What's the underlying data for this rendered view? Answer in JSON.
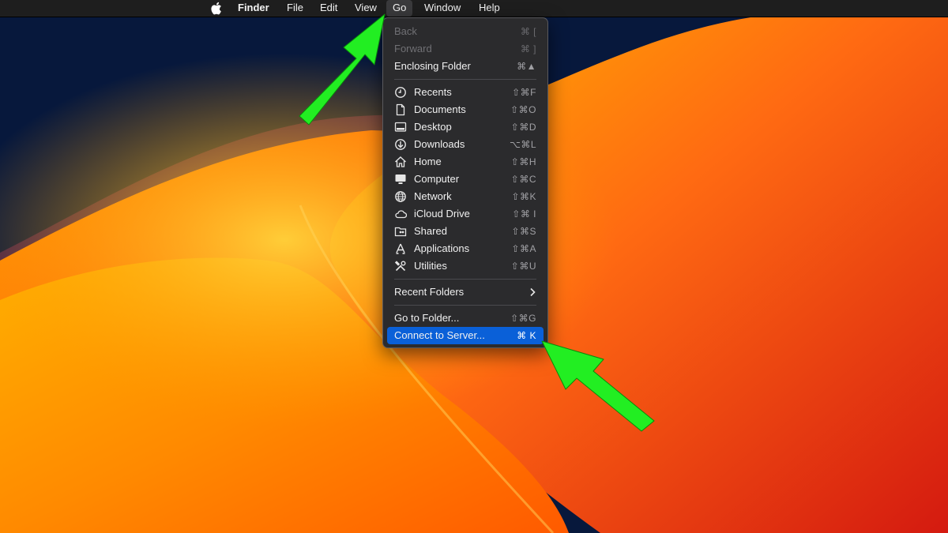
{
  "menubar": {
    "apple_icon": "apple-logo-icon",
    "items": [
      {
        "label": "Finder"
      },
      {
        "label": "File"
      },
      {
        "label": "Edit"
      },
      {
        "label": "View"
      },
      {
        "label": "Go"
      },
      {
        "label": "Window"
      },
      {
        "label": "Help"
      }
    ],
    "active_item": "Go"
  },
  "go_menu": {
    "history": [
      {
        "label": "Back",
        "shortcut": "⌘ [",
        "enabled": false
      },
      {
        "label": "Forward",
        "shortcut": "⌘ ]",
        "enabled": false
      },
      {
        "label": "Enclosing Folder",
        "shortcut": "⌘▲",
        "enabled": true
      }
    ],
    "places": [
      {
        "label": "Recents",
        "shortcut": "⇧⌘F",
        "icon": "clock-icon"
      },
      {
        "label": "Documents",
        "shortcut": "⇧⌘O",
        "icon": "document-icon"
      },
      {
        "label": "Desktop",
        "shortcut": "⇧⌘D",
        "icon": "desktop-icon"
      },
      {
        "label": "Downloads",
        "shortcut": "⌥⌘L",
        "icon": "download-icon"
      },
      {
        "label": "Home",
        "shortcut": "⇧⌘H",
        "icon": "home-icon"
      },
      {
        "label": "Computer",
        "shortcut": "⇧⌘C",
        "icon": "computer-icon"
      },
      {
        "label": "Network",
        "shortcut": "⇧⌘K",
        "icon": "globe-icon"
      },
      {
        "label": "iCloud Drive",
        "shortcut": "⇧⌘ I",
        "icon": "cloud-icon"
      },
      {
        "label": "Shared",
        "shortcut": "⇧⌘S",
        "icon": "shared-folder-icon"
      },
      {
        "label": "Applications",
        "shortcut": "⇧⌘A",
        "icon": "applications-icon"
      },
      {
        "label": "Utilities",
        "shortcut": "⇧⌘U",
        "icon": "utilities-icon"
      }
    ],
    "recent_folders": {
      "label": "Recent Folders",
      "icon": "chevron-right-icon"
    },
    "go_to_folder": {
      "label": "Go to Folder...",
      "shortcut": "⇧⌘G"
    },
    "connect_to_server": {
      "label": "Connect to Server...",
      "shortcut": "⌘ K",
      "selected": true
    }
  },
  "colors": {
    "menubar_bg": "#1e1e1e",
    "menu_bg": "#2b2b2d",
    "selection": "#0a60d8",
    "annotation_arrow": "#22ee22"
  }
}
